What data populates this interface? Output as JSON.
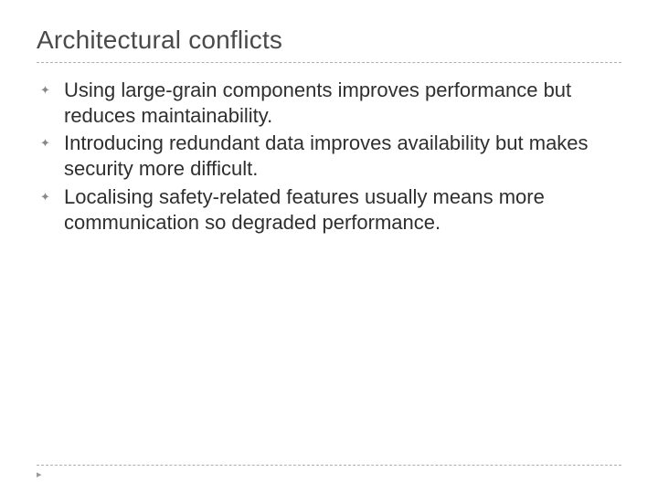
{
  "title": "Architectural conflicts",
  "bullets": [
    {
      "text": "Using large-grain components improves performance but reduces maintainability."
    },
    {
      "text": "Introducing redundant data improves availability but makes security more difficult."
    },
    {
      "text": "Localising safety-related features usually means more communication so degraded performance."
    }
  ],
  "bullet_glyph": "✦",
  "footer_glyph": "▸"
}
